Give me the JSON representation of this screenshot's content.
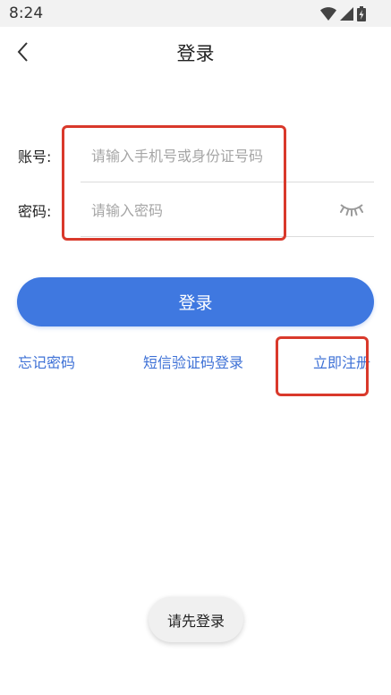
{
  "status_bar": {
    "time": "8:24",
    "icons": [
      "wifi-icon",
      "signal-icon",
      "battery-charging-icon"
    ]
  },
  "header": {
    "title": "登录",
    "back_icon": "chevron-left-icon"
  },
  "form": {
    "account": {
      "label": "账号:",
      "placeholder": "请输入手机号或身份证号码",
      "value": ""
    },
    "password": {
      "label": "密码:",
      "placeholder": "请输入密码",
      "value": "",
      "toggle_icon": "eye-closed-icon"
    }
  },
  "login_button": {
    "label": "登录"
  },
  "links": {
    "forgot": "忘记密码",
    "sms_login": "短信验证码登录",
    "register": "立即注册"
  },
  "toast": {
    "text": "请先登录"
  },
  "colors": {
    "accent": "#3f78e0",
    "link": "#3e71d6",
    "annotation": "#d9392b"
  }
}
